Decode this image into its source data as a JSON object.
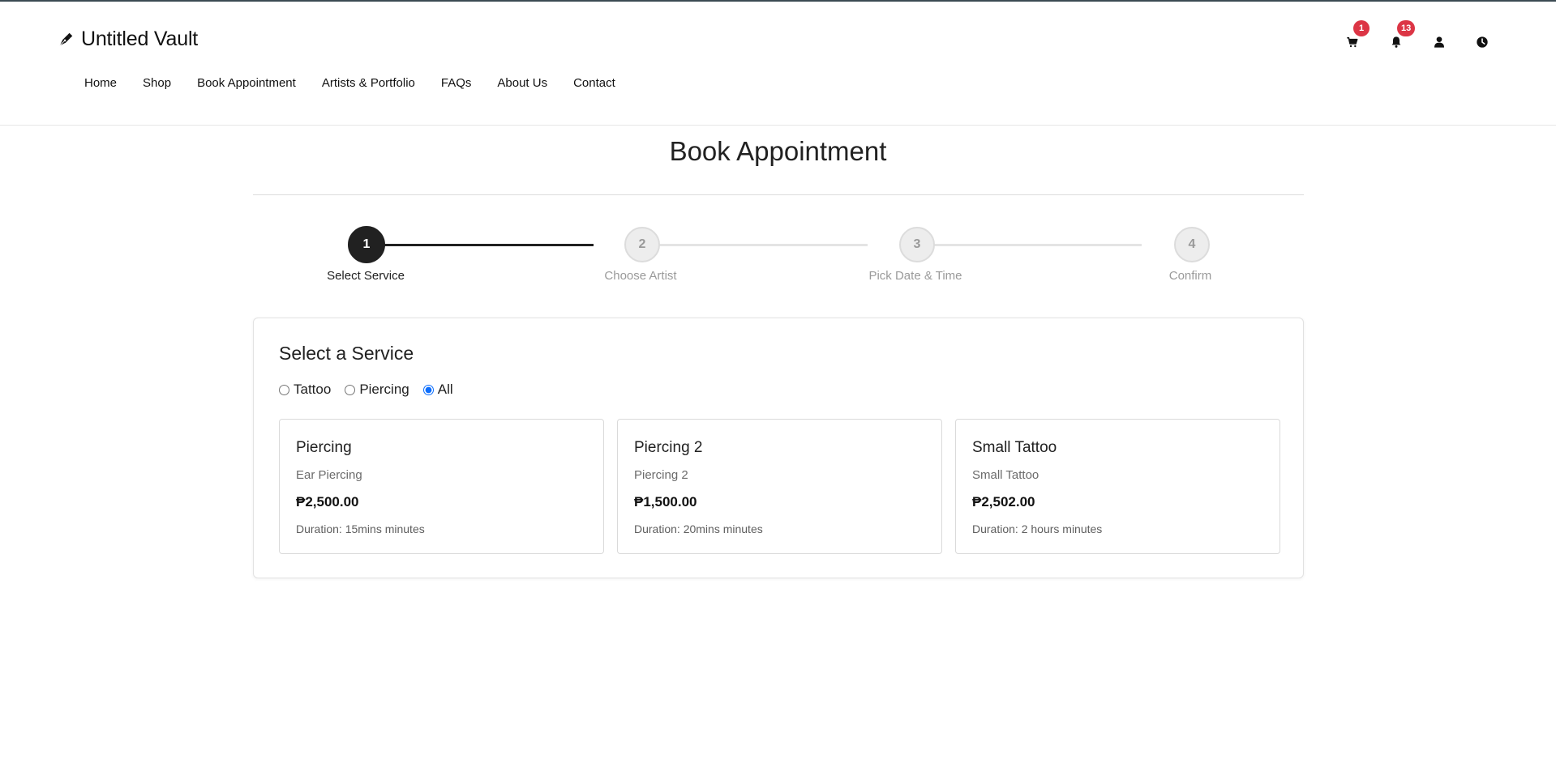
{
  "brand": {
    "name": "Untitled Vault",
    "icon": "pen-nib-icon"
  },
  "nav": {
    "items": [
      {
        "label": "Home"
      },
      {
        "label": "Shop"
      },
      {
        "label": "Book Appointment"
      },
      {
        "label": "Artists & Portfolio"
      },
      {
        "label": "FAQs"
      },
      {
        "label": "About Us"
      },
      {
        "label": "Contact"
      }
    ]
  },
  "header_actions": {
    "cart_badge": "1",
    "notifications_badge": "13",
    "icons": [
      "cart-icon",
      "bell-icon",
      "user-icon",
      "clock-icon"
    ]
  },
  "page": {
    "title": "Book Appointment"
  },
  "stepper": {
    "steps": [
      {
        "number": "1",
        "label": "Select Service",
        "active": true
      },
      {
        "number": "2",
        "label": "Choose Artist",
        "active": false
      },
      {
        "number": "3",
        "label": "Pick Date & Time",
        "active": false
      },
      {
        "number": "4",
        "label": "Confirm",
        "active": false
      }
    ]
  },
  "service_panel": {
    "title": "Select a Service",
    "filters": [
      {
        "label": "Tattoo",
        "checked": false
      },
      {
        "label": "Piercing",
        "checked": false
      },
      {
        "label": "All",
        "checked": true
      }
    ],
    "services": [
      {
        "name": "Piercing",
        "subtitle": "Ear Piercing",
        "price": "₱2,500.00",
        "duration": "Duration: 15mins minutes"
      },
      {
        "name": "Piercing 2",
        "subtitle": "Piercing 2",
        "price": "₱1,500.00",
        "duration": "Duration: 20mins minutes"
      },
      {
        "name": "Small Tattoo",
        "subtitle": "Small Tattoo",
        "price": "₱2,502.00",
        "duration": "Duration: 2 hours minutes"
      }
    ]
  },
  "colors": {
    "accent_dark": "#212121",
    "badge_red": "#dc3545",
    "radio_blue": "#0d6efd"
  }
}
